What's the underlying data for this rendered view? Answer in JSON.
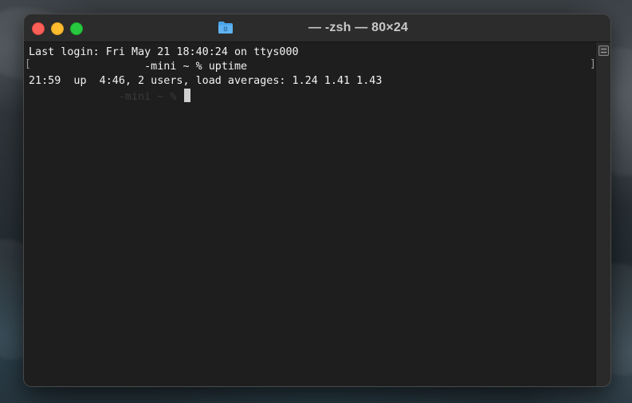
{
  "window": {
    "title": "— -zsh — 80×24"
  },
  "terminal": {
    "lines": [
      "Last login: Fri May 21 18:40:24 on ttys000",
      "                  -mini ~ % uptime",
      "21:59  up  4:46, 2 users, load averages: 1.24 1.41 1.43"
    ],
    "prompt_faded": "              -mini ~ % ",
    "left_bracket": "[",
    "right_bracket": "]"
  },
  "colors": {
    "close": "#fe5f57",
    "minimize": "#febc2e",
    "maximize": "#28c840",
    "terminal_bg": "#1e1e1e",
    "folder": "#4aa3e8"
  },
  "icons": {
    "title_icon": "folder-icon",
    "scroll_icon": "list-icon"
  }
}
